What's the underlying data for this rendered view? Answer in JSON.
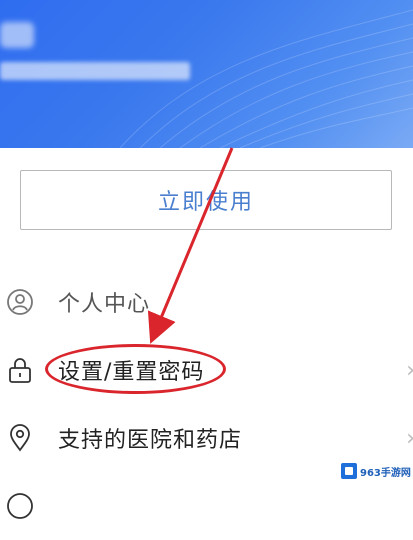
{
  "header": {
    "user_name_blurred": "",
    "user_sub_blurred": ""
  },
  "use_button": {
    "label": "立即使用"
  },
  "menu": {
    "items": [
      {
        "label": "个人中心",
        "icon": "person-icon"
      },
      {
        "label": "设置/重置密码",
        "icon": "lock-icon"
      },
      {
        "label": "支持的医院和药店",
        "icon": "location-pin-icon"
      }
    ]
  },
  "watermark": {
    "text": "963手游网"
  },
  "colors": {
    "header_blue": "#3a78ee",
    "button_text": "#4a7fcf",
    "annotation_red": "#d9252b"
  }
}
